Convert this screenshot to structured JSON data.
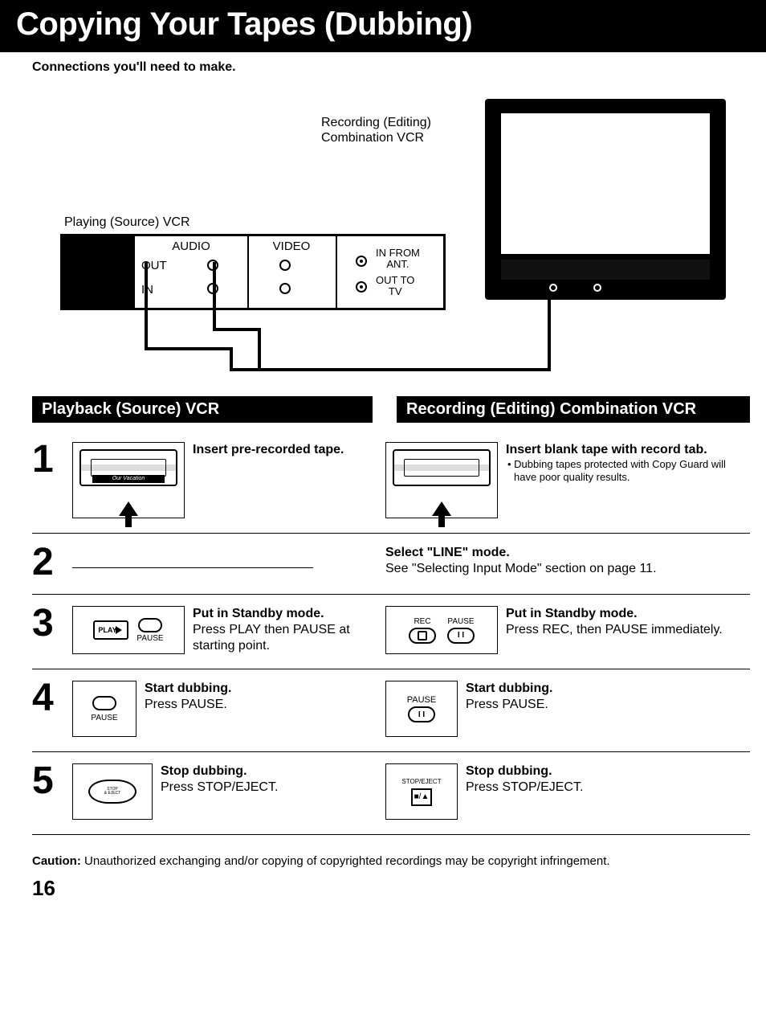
{
  "title": "Copying Your Tapes (Dubbing)",
  "subtitle": "Connections you'll need to make.",
  "diagram": {
    "recording_vcr_label": "Recording (Editing)\nCombination VCR",
    "playing_vcr_label": "Playing (Source) VCR",
    "panel": {
      "audio": "AUDIO",
      "video": "VIDEO",
      "out": "OUT",
      "in": "IN",
      "in_from_ant": "IN FROM\nANT.",
      "out_to_tv": "OUT TO\nTV"
    }
  },
  "columns": {
    "left_header": "Playback (Source) VCR",
    "right_header": "Recording (Editing) Combination VCR"
  },
  "cassette_label": "Our Vacation",
  "steps": [
    {
      "num": "1",
      "left": {
        "heading": "Insert pre-recorded tape.",
        "body": ""
      },
      "right": {
        "heading": "Insert blank tape with record tab.",
        "bullet": "Dubbing tapes protected with Copy Guard will have poor quality results."
      }
    },
    {
      "num": "2",
      "right": {
        "heading": "Select \"LINE\" mode.",
        "body": "See \"Selecting Input Mode\" section on page 11."
      }
    },
    {
      "num": "3",
      "left": {
        "heading": "Put in Standby mode.",
        "body": "Press PLAY then PAUSE at starting point.",
        "btn_play": "PLAY",
        "btn_pause": "PAUSE"
      },
      "right": {
        "heading": "Put in Standby mode.",
        "body": "Press REC, then PAUSE immediately.",
        "btn_rec": "REC",
        "btn_pause": "PAUSE"
      }
    },
    {
      "num": "4",
      "left": {
        "heading": "Start dubbing.",
        "body": "Press PAUSE.",
        "btn_pause": "PAUSE"
      },
      "right": {
        "heading": "Start dubbing.",
        "body": "Press PAUSE.",
        "btn_pause": "PAUSE"
      }
    },
    {
      "num": "5",
      "left": {
        "heading": "Stop dubbing.",
        "body": "Press STOP/EJECT.",
        "btn_label": "STOP\n& EJECT"
      },
      "right": {
        "heading": "Stop dubbing.",
        "body": "Press STOP/EJECT.",
        "btn_stopej": "STOP/EJECT",
        "btn_sym": "■/▲"
      }
    }
  ],
  "caution_label": "Caution:",
  "caution_text": " Unauthorized exchanging and/or copying of copyrighted recordings may be copyright infringement.",
  "page_number": "16"
}
